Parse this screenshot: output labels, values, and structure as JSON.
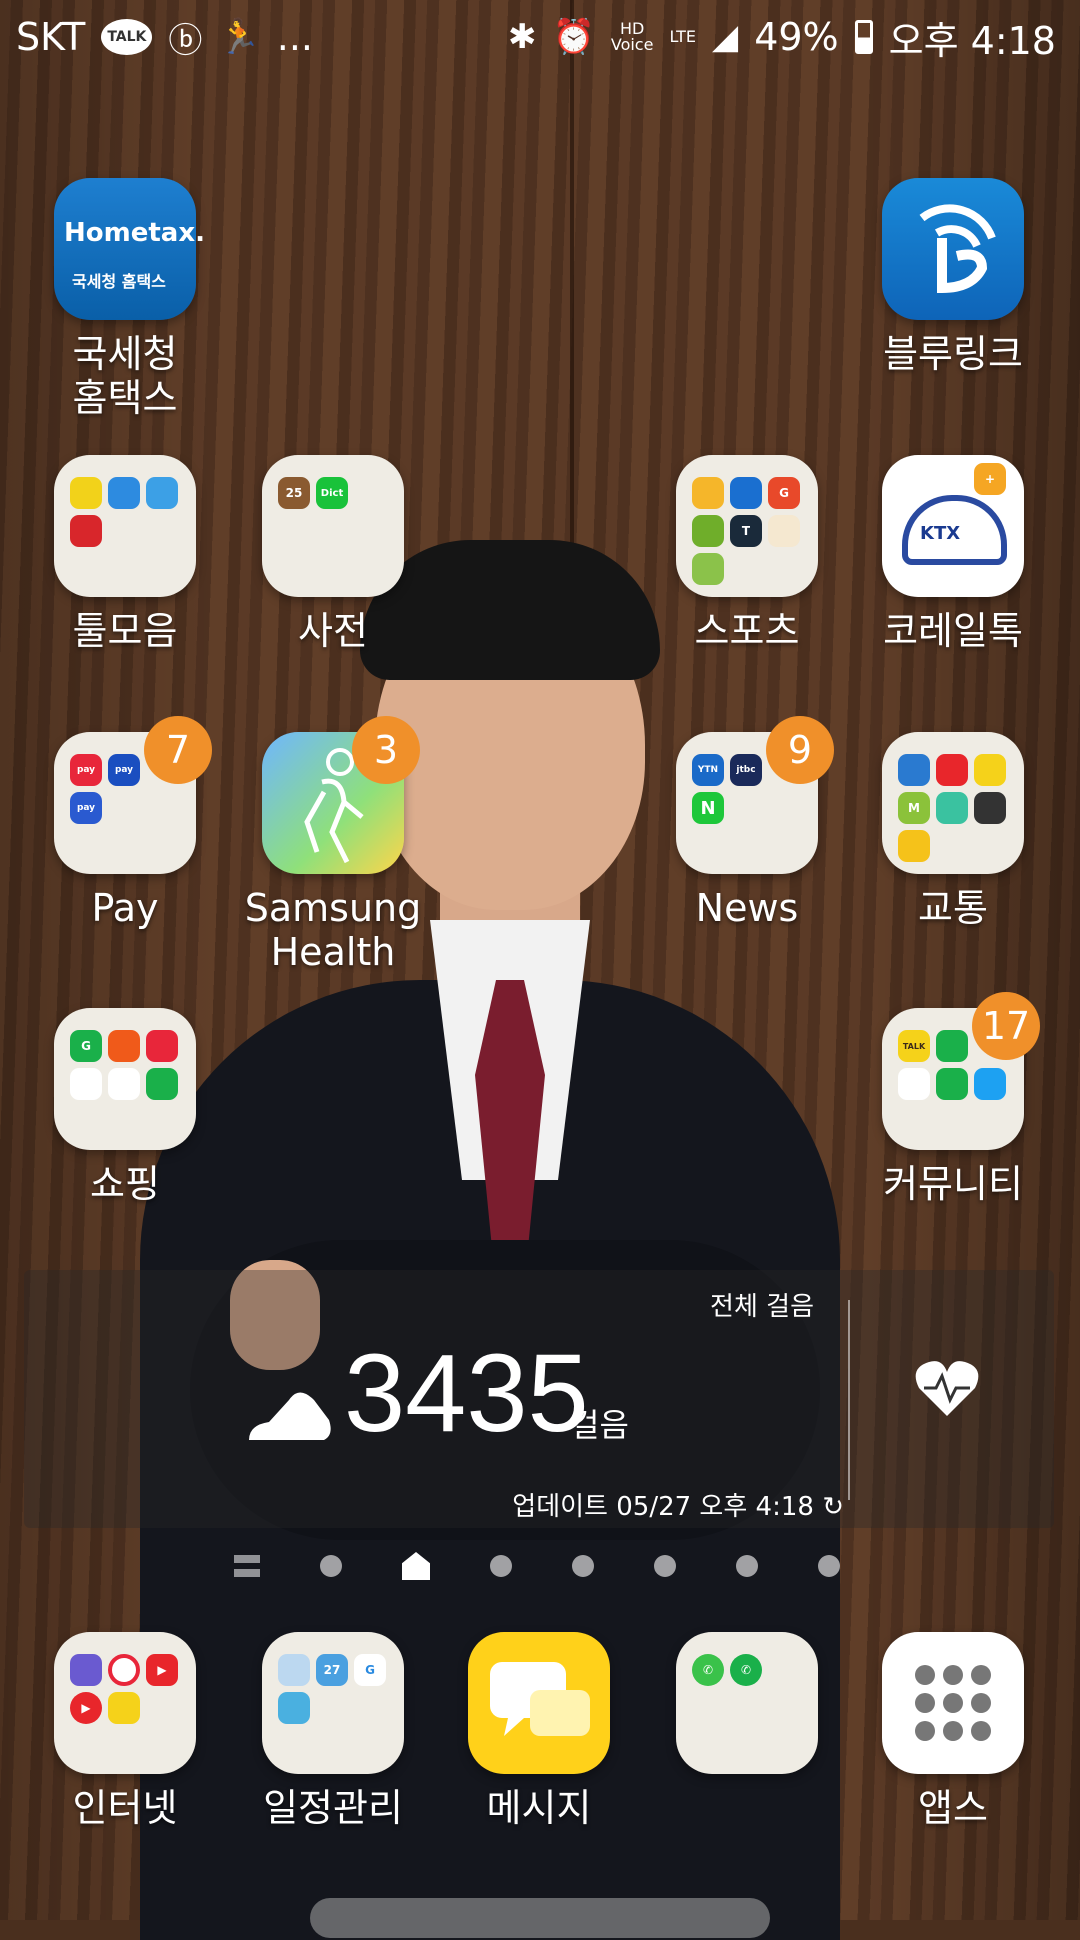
{
  "status_bar": {
    "carrier": "SKT",
    "talk_badge": "TALK",
    "more": "...",
    "hd_voice_top": "HD",
    "hd_voice_bottom": "Voice",
    "lte": "LTE",
    "battery": "49%",
    "time": "오후 4:18"
  },
  "apps": {
    "hometax": {
      "label": "국세청\n홈택스",
      "logo_text": "Hometax.",
      "logo_sub": "국세청 홈택스"
    },
    "bluelink": {
      "label": "블루링크"
    },
    "tools": {
      "label": "툴모음"
    },
    "dictionary": {
      "label": "사전",
      "mini1": "25",
      "mini2": "Dict"
    },
    "sports": {
      "label": "스포츠"
    },
    "korail": {
      "label": "코레일톡",
      "logo": "KTX"
    },
    "pay": {
      "label": "Pay",
      "badge": "7",
      "mini1": "pay",
      "mini2": "pay",
      "mini3": "pay"
    },
    "health": {
      "label": "Samsung\nHealth",
      "badge": "3"
    },
    "news": {
      "label": "News",
      "badge": "9",
      "mini1": "YTN",
      "mini2": "jtbc",
      "mini3": "N"
    },
    "transit": {
      "label": "교통"
    },
    "shopping": {
      "label": "쇼핑"
    },
    "community": {
      "label": "커뮤니티",
      "badge": "17",
      "mini1": "TALK"
    }
  },
  "widget": {
    "title": "전체 걸음",
    "steps": "3435",
    "unit": "걸음",
    "updated": "업데이트 05/27 오후 4:18"
  },
  "dock": {
    "internet": {
      "label": "인터넷"
    },
    "calendar": {
      "label": "일정관리",
      "mini": "27"
    },
    "messages": {
      "label": "메시지"
    },
    "phone": {
      "label": ""
    },
    "apps": {
      "label": "앱스"
    }
  },
  "colors": {
    "badge": "#f0902a",
    "message_yellow": "#ffd11a"
  }
}
